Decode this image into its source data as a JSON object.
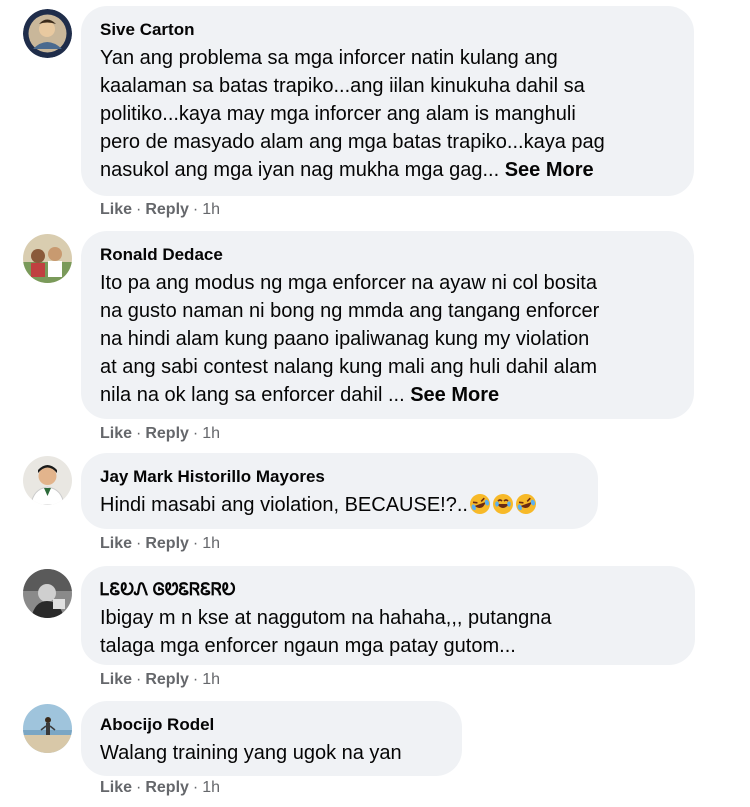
{
  "actions": {
    "like": "Like",
    "reply": "Reply",
    "separator": "·"
  },
  "comments": [
    {
      "author": "Sive Carton",
      "text": "Yan ang problema sa mga inforcer natin kulang ang\nkaalaman sa batas trapiko...ang iilan kinukuha dahil sa\npolitiko...kaya may mga inforcer ang alam is manghuli\npero de masyado alam ang mga batas trapiko...kaya pag\nnasukol ang mga iyan nag mukha mga gag...",
      "see_more": "See More",
      "time": "1h",
      "avatar_icon": "user-avatar"
    },
    {
      "author": "Ronald Dedace",
      "text": "Ito pa ang modus ng mga enforcer na ayaw ni col bosita\nna gusto naman ni bong ng mmda ang tangang enforcer\nna hindi alam kung paano ipaliwanag kung my violation\nat ang sabi contest nalang kung mali ang huli dahil alam\nnila na ok lang sa enforcer dahil ...",
      "see_more": "See More",
      "time": "1h",
      "avatar_icon": "user-avatar"
    },
    {
      "author": "Jay Mark Historillo Mayores",
      "text": "Hindi masabi ang violation, BECAUSE!?..",
      "emojis": [
        "rolling-laughing-emoji",
        "grinning-sweat-emoji",
        "rolling-laughing-emoji"
      ],
      "time": "1h",
      "avatar_icon": "user-avatar"
    },
    {
      "author": "ᏞᏋᎧᏁ ᎶᏬᏋᏒᏋᏒᎧ",
      "text": "Ibigay m n kse at naggutom na hahaha,,, putangna\ntalaga mga enforcer ngaun mga patay gutom...",
      "time": "1h",
      "avatar_icon": "user-avatar"
    },
    {
      "author": "Abocijo Rodel",
      "text": "Walang training yang ugok na yan",
      "time": "1h",
      "avatar_icon": "user-avatar"
    }
  ],
  "colors": {
    "bubble": "#f0f2f5",
    "text": "#050505",
    "meta": "#65676b"
  }
}
